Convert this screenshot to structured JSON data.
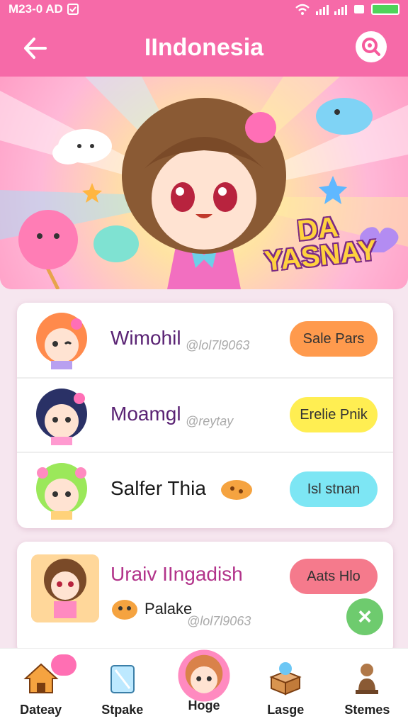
{
  "status_bar": {
    "left_text": "M23-0 AD"
  },
  "header": {
    "title": "IIndonesia"
  },
  "banner": {
    "logo_text_1": "DA",
    "logo_text_2": "YASNAY"
  },
  "list": [
    {
      "name": "Wimohil",
      "handle": "@lol7l9063",
      "action": "Sale Pars",
      "pill_color": "#ff9a4d"
    },
    {
      "name": "Moamgl",
      "handle": "@reytay",
      "action": "Erelie Pnik",
      "pill_color": "#ffee52"
    },
    {
      "name": "Salfer Thia",
      "handle": "",
      "action": "Isl stnan",
      "pill_color": "#7de6f4"
    }
  ],
  "card2": {
    "title": "Uraiv IIngadish",
    "sub": "Palake",
    "handle": "@lol7l9063",
    "action": "Aats Hlo"
  },
  "nav": [
    {
      "label": "Dateay",
      "icon": "house-icon"
    },
    {
      "label": "Stpake",
      "icon": "ice-cube-icon"
    },
    {
      "label": "Hoge",
      "icon": "avatar-icon"
    },
    {
      "label": "Lasge",
      "icon": "box-icon"
    },
    {
      "label": "Stemes",
      "icon": "figure-icon"
    }
  ],
  "colors": {
    "primary": "#f66aa8",
    "card2_pill": "#f57a8c"
  }
}
